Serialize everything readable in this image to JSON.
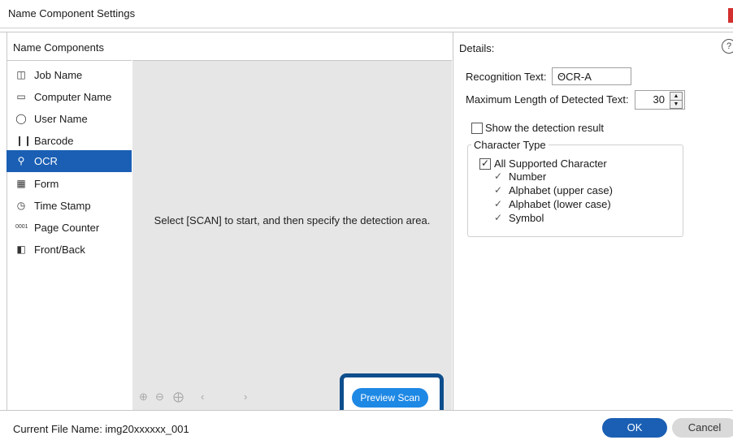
{
  "window": {
    "title": "Name Component Settings"
  },
  "left_panel": {
    "header": "Name Components",
    "items": [
      {
        "label": "Job Name",
        "icon": "job-name-icon",
        "selected": false
      },
      {
        "label": "Computer Name",
        "icon": "computer-icon",
        "selected": false
      },
      {
        "label": "User Name",
        "icon": "user-icon",
        "selected": false
      },
      {
        "label": "Barcode",
        "icon": "barcode-icon",
        "selected": false
      },
      {
        "label": "OCR",
        "icon": "ocr-icon",
        "selected": true
      },
      {
        "label": "Form",
        "icon": "form-icon",
        "selected": false
      },
      {
        "label": "Time Stamp",
        "icon": "time-stamp-icon",
        "selected": false
      },
      {
        "label": "Page Counter",
        "icon": "page-counter-icon",
        "selected": false
      },
      {
        "label": "Front/Back",
        "icon": "front-back-icon",
        "selected": false
      }
    ]
  },
  "preview": {
    "message": "Select [SCAN] to start, and then specify the detection area.",
    "preview_scan_label": "Preview Scan"
  },
  "details": {
    "title": "Details:",
    "recognition_text_label": "Recognition Text:",
    "recognition_text_value": "OCR-A",
    "max_length_label": "Maximum Length of Detected Text:",
    "max_length_value": "30",
    "show_detection_label": "Show the detection result",
    "show_detection_checked": false,
    "character_type": {
      "legend": "Character Type",
      "all_label": "All Supported Character",
      "all_checked": true,
      "options": [
        {
          "label": "Number",
          "checked": true
        },
        {
          "label": "Alphabet (upper case)",
          "checked": true
        },
        {
          "label": "Alphabet (lower case)",
          "checked": true
        },
        {
          "label": "Symbol",
          "checked": true
        }
      ]
    }
  },
  "footer": {
    "current_file": "Current File Name: img20xxxxxx_001",
    "ok_label": "OK",
    "cancel_label": "Cancel"
  },
  "colors": {
    "accent": "#1a5fb4",
    "preview_button": "#1e88e5",
    "highlight": "#0f4e8c"
  }
}
